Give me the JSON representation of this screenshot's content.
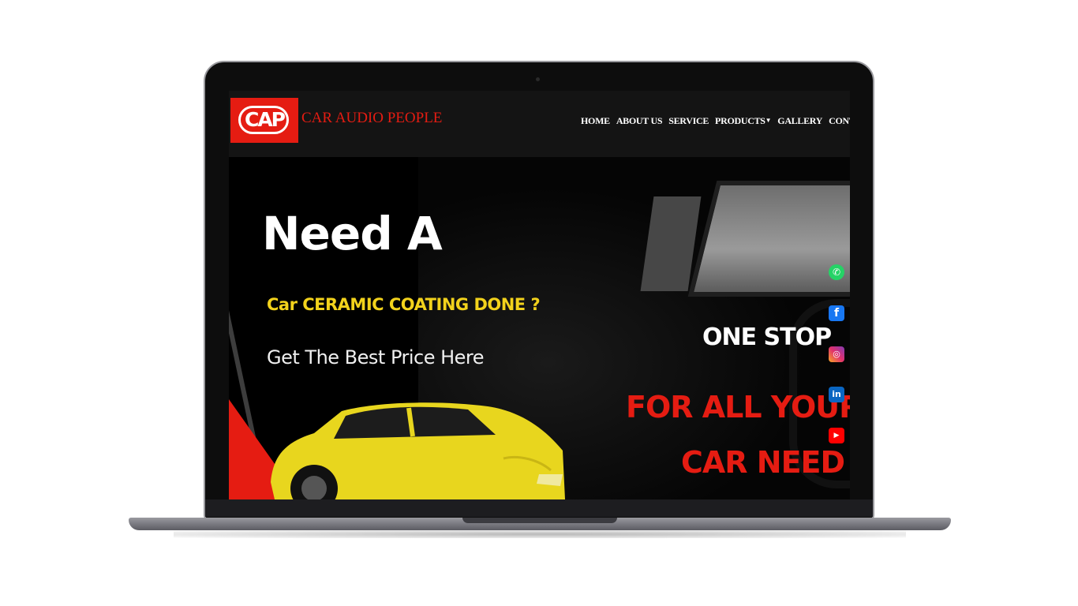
{
  "brand": {
    "logo_text": "CAP",
    "name": "CAR AUDIO PEOPLE",
    "color": "#e51c12"
  },
  "nav": {
    "items": [
      "HOME",
      "ABOUT US",
      "SERVICE",
      "PRODUCTS",
      "GALLERY",
      "CONTACT"
    ]
  },
  "hero": {
    "headline": "Need A",
    "subheadline": "Car CERAMIC COATING DONE ?",
    "tagline": "Get The Best Price Here",
    "one_stop": "ONE STOP",
    "for_all": "FOR ALL YOUR",
    "car_need": "CAR NEED"
  },
  "social": {
    "icons": [
      "whatsapp-icon",
      "facebook-icon",
      "instagram-icon",
      "linkedin-icon",
      "youtube-icon"
    ]
  },
  "colors": {
    "accent_red": "#e51c12",
    "accent_yellow": "#f2d21c"
  }
}
